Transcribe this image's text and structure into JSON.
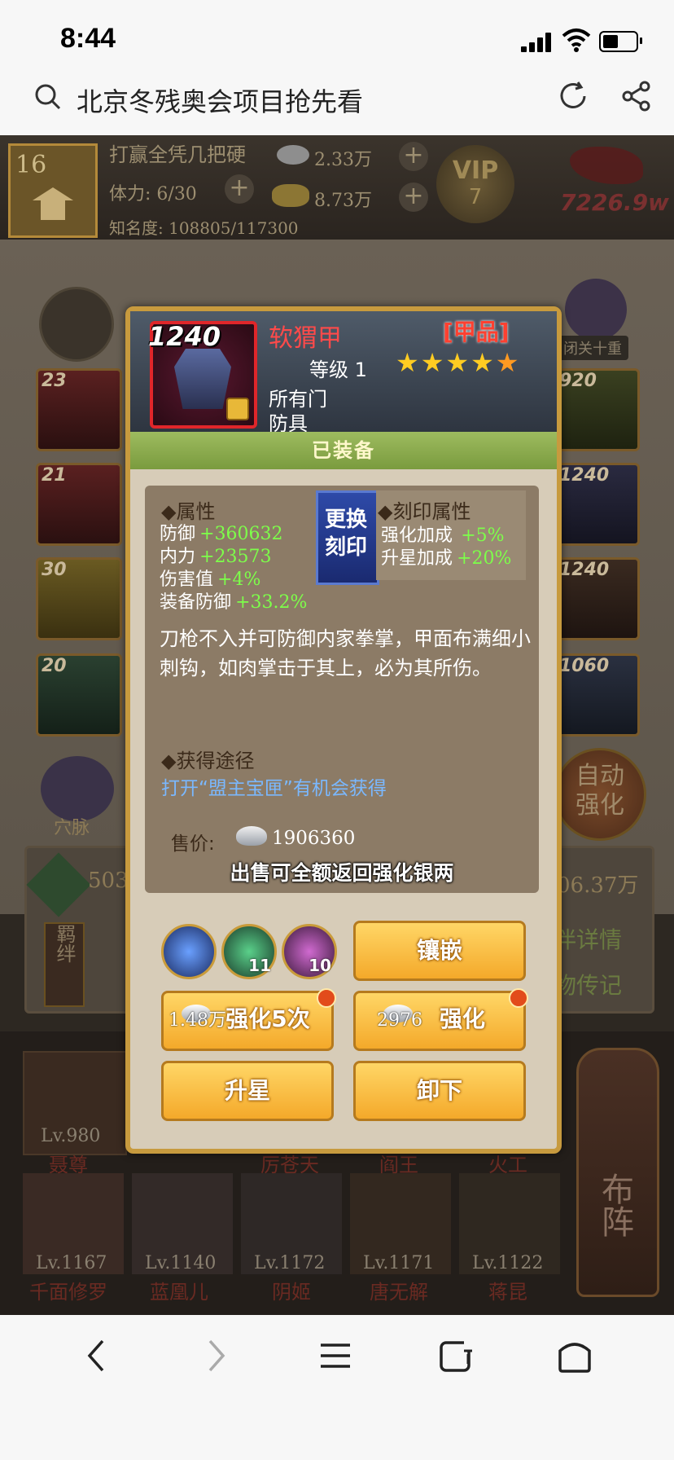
{
  "status_bar": {
    "time": "8:44"
  },
  "browser": {
    "search_text": "北京冬残奥会项目抢先看"
  },
  "game_background": {
    "level": "16",
    "player_name": "打赢全凭几把硬",
    "stamina": "体力: 6/30",
    "fame": "知名度: 108805/117300",
    "silver": "2.33万",
    "gold": "8.73万",
    "vip": "VIP",
    "vip_level": "7",
    "combat_power": "7226.9w",
    "retreat_label": "闭关十重",
    "left_slots": [
      "23",
      "21",
      "30",
      "20"
    ],
    "right_slots": [
      "920",
      "1240",
      "1240",
      "1060"
    ],
    "meridian": "穴脉",
    "auto_enhance": "自动强化",
    "bond": "羁绊",
    "ming_value": "503",
    "right_value": "06.37万",
    "bond_detail": "伴详情",
    "story": "物传记",
    "heroes_row1": [
      {
        "level": "Lv.980",
        "name": "聂尊"
      },
      {
        "level": "",
        "name": "厉苍天"
      },
      {
        "level": "",
        "name": "阎王"
      },
      {
        "level": "",
        "name": "火工"
      }
    ],
    "heroes_row2": [
      {
        "level": "Lv.1167",
        "name": "千面修罗"
      },
      {
        "level": "Lv.1140",
        "name": "蓝凰儿"
      },
      {
        "level": "Lv.1172",
        "name": "阴姬"
      },
      {
        "level": "Lv.1171",
        "name": "唐无解"
      },
      {
        "level": "Lv.1122",
        "name": "蒋昆"
      }
    ],
    "formation": "布阵"
  },
  "dialog": {
    "item_power": "1240",
    "item_name": "软猬甲",
    "grade": "[甲品]",
    "level_label": "等级 1",
    "stars": 5,
    "sect": "所有门",
    "type": "防具",
    "equipped": "已装备",
    "attr_header": "◆属性",
    "attributes": [
      {
        "name": "防御",
        "value": "+360632"
      },
      {
        "name": "内力",
        "value": "+23573"
      },
      {
        "name": "伤害值",
        "value": "+4%"
      },
      {
        "name": "装备防御",
        "value": "+33.2%"
      }
    ],
    "change_seal": "更换刻印",
    "seal_header": "◆刻印属性",
    "seal_attributes": [
      {
        "name": "强化加成",
        "value": "+5%"
      },
      {
        "name": "升星加成",
        "value": "+20%"
      }
    ],
    "description": "刀枪不入并可防御内家拳掌，甲面布满细小刺钩，如肉掌击于其上，必为其所伤。",
    "obtain_header": "◆获得途径",
    "obtain_text": "打开“盟主宝匣”有机会获得",
    "sell_label": "售价:",
    "sell_price": "1906360",
    "sell_note": "出售可全额返回强化银两",
    "gem_counts": [
      "",
      "11",
      "10"
    ],
    "buttons": {
      "inlay": "镶嵌",
      "enhance5": "强化5次",
      "enhance5_cost": "1.48万",
      "enhance": "强化",
      "enhance_cost": "2976",
      "star_up": "升星",
      "unequip": "卸下"
    }
  }
}
